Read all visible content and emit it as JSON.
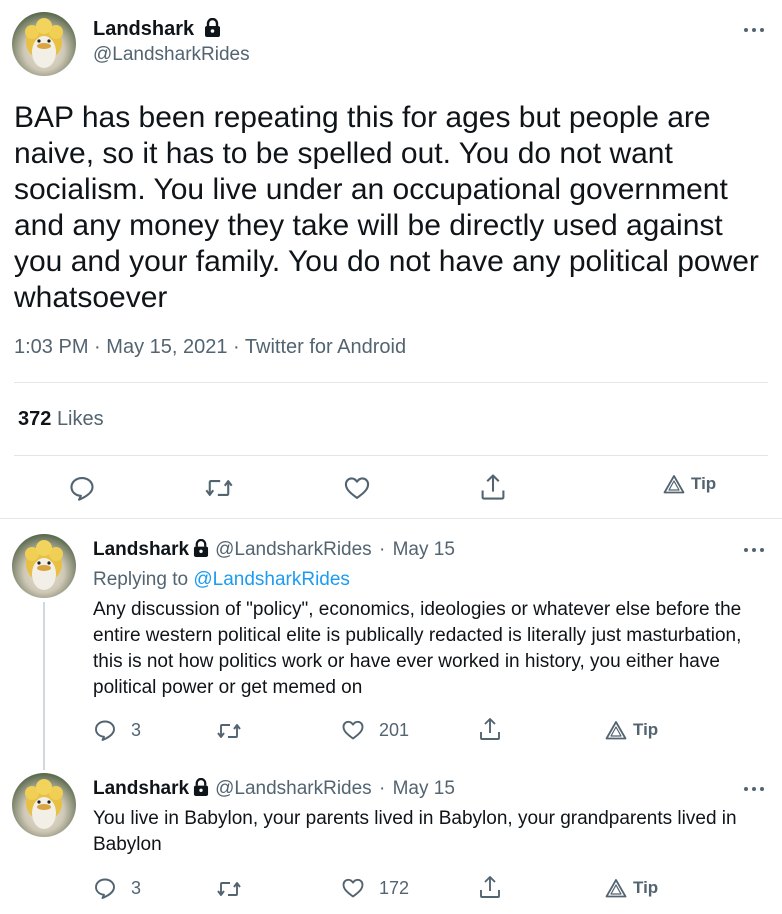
{
  "main_tweet": {
    "author_name": "Landshark",
    "author_handle": "@LandsharkRides",
    "text": "BAP has been repeating this for ages but people are naive, so it has to be spelled out. You do not want socialism. You live under an occupational government and any money they take will be directly used against you and your family. You do not have any political power whatsoever",
    "time": "1:03 PM",
    "date": "May 15, 2021",
    "source": "Twitter for Android",
    "likes_count": "372",
    "likes_label": "Likes",
    "tip_label": "Tip"
  },
  "replies": [
    {
      "author_name": "Landshark",
      "author_handle": "@LandsharkRides",
      "date": "May 15",
      "replying_prefix": "Replying to",
      "replying_handle": "@LandsharkRides",
      "text": "Any discussion of \"policy\", economics, ideologies or whatever else before the entire western political elite is publically redacted is literally just masturbation, this is not how politics work or have ever worked in history, you either have political power or get memed on",
      "reply_count": "3",
      "like_count": "201",
      "tip_label": "Tip"
    },
    {
      "author_name": "Landshark",
      "author_handle": "@LandsharkRides",
      "date": "May 15",
      "text": "You live in Babylon, your parents lived in Babylon, your grandparents lived in Babylon",
      "reply_count": "3",
      "like_count": "172",
      "tip_label": "Tip"
    }
  ],
  "separator": "·",
  "icons": {
    "reply": "reply-icon",
    "retweet": "retweet-icon",
    "like": "heart-icon",
    "share": "share-icon",
    "tip": "tip-icon",
    "lock": "lock-icon",
    "more": "more-icon"
  },
  "colors": {
    "text": "#0f1419",
    "secondary": "#536471",
    "link": "#1d9bf0",
    "divider": "#e1e6ea"
  }
}
